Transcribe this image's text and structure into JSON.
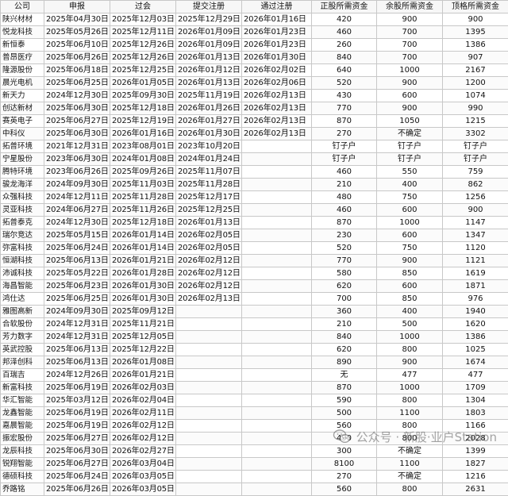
{
  "headers": [
    "公司",
    "申报",
    "过会",
    "提交注册",
    "通过注册",
    "正股所需资金",
    "余股所需资金",
    "顶格所需资金"
  ],
  "rows": [
    [
      "陕兴材材",
      "2025年04月30日",
      "2025年12月03日",
      "2025年12月29日",
      "2026年01月16日",
      "420",
      "900",
      "900"
    ],
    [
      "悦龙科技",
      "2025年05月26日",
      "2025年12月11日",
      "2026年01月09日",
      "2026年01月23日",
      "460",
      "700",
      "1395"
    ],
    [
      "新恒泰",
      "2025年06月10日",
      "2025年12月26日",
      "2026年01月09日",
      "2026年01月23日",
      "260",
      "700",
      "1386"
    ],
    [
      "普昂医疗",
      "2025年06月26日",
      "2025年12月26日",
      "2026年01月13日",
      "2026年01月30日",
      "840",
      "700",
      "907"
    ],
    [
      "隆源股份",
      "2025年06月18日",
      "2025年12月25日",
      "2026年01月12日",
      "2026年02月02日",
      "640",
      "1000",
      "2167"
    ],
    [
      "晨光电机",
      "2025年06月25日",
      "2026年01月05日",
      "2026年01月13日",
      "2026年02月06日",
      "520",
      "900",
      "1200"
    ],
    [
      "新天力",
      "2024年12月30日",
      "2025年09月30日",
      "2025年11月19日",
      "2026年02月13日",
      "430",
      "600",
      "1074"
    ],
    [
      "创达新材",
      "2025年06月30日",
      "2025年12月18日",
      "2026年01月26日",
      "2026年02月13日",
      "770",
      "900",
      "990"
    ],
    [
      "赛英电子",
      "2025年06月27日",
      "2025年12月19日",
      "2026年01月27日",
      "2026年02月13日",
      "870",
      "1050",
      "1215"
    ],
    [
      "中科仪",
      "2025年06月30日",
      "2026年01月16日",
      "2026年01月30日",
      "2026年02月13日",
      "270",
      "不确定",
      "3302"
    ],
    [
      "拓普环境",
      "2021年12月31日",
      "2023年08月01日",
      "2023年10月20日",
      "",
      "钉子户",
      "钉子户",
      "钉子户"
    ],
    [
      "宁星股份",
      "2023年06月30日",
      "2024年01月08日",
      "2024年01月24日",
      "",
      "钉子户",
      "钉子户",
      "钉子户"
    ],
    [
      "腾特环境",
      "2023年06月26日",
      "2025年09月26日",
      "2025年11月07日",
      "",
      "460",
      "550",
      "759"
    ],
    [
      "骏龙海洋",
      "2024年09月30日",
      "2025年11月03日",
      "2025年11月28日",
      "",
      "210",
      "400",
      "862"
    ],
    [
      "众强科技",
      "2024年12月11日",
      "2025年11月28日",
      "2025年12月17日",
      "",
      "480",
      "750",
      "1256"
    ],
    [
      "灵亚科技",
      "2024年06月27日",
      "2025年11月26日",
      "2025年12月25日",
      "",
      "460",
      "600",
      "900"
    ],
    [
      "拓普泰克",
      "2024年12月30日",
      "2025年12月18日",
      "2026年01月13日",
      "",
      "870",
      "1000",
      "1147"
    ],
    [
      "瑞尔竞达",
      "2025年05月15日",
      "2026年01月14日",
      "2026年02月05日",
      "",
      "230",
      "600",
      "1347"
    ],
    [
      "弥富科技",
      "2025年06月24日",
      "2026年01月14日",
      "2026年02月05日",
      "",
      "520",
      "750",
      "1120"
    ],
    [
      "恒湖科技",
      "2025年06月13日",
      "2026年01月21日",
      "2026年02月12日",
      "",
      "770",
      "900",
      "1121"
    ],
    [
      "沛诚科技",
      "2025年05月22日",
      "2026年01月28日",
      "2026年02月12日",
      "",
      "580",
      "850",
      "1619"
    ],
    [
      "海昌智能",
      "2025年06月23日",
      "2026年01月30日",
      "2026年02月12日",
      "",
      "620",
      "600",
      "1871"
    ],
    [
      "鸿仕达",
      "2025年06月25日",
      "2026年01月30日",
      "2026年02月13日",
      "",
      "700",
      "850",
      "976"
    ],
    [
      "雅图高新",
      "2024年09月30日",
      "2025年09月12日",
      "",
      "",
      "360",
      "400",
      "1940"
    ],
    [
      "合软股份",
      "2024年12月31日",
      "2025年11月21日",
      "",
      "",
      "210",
      "500",
      "1620"
    ],
    [
      "芳力数字",
      "2024年12月31日",
      "2025年12月05日",
      "",
      "",
      "840",
      "1000",
      "1386"
    ],
    [
      "英武控股",
      "2025年06月13日",
      "2025年12月22日",
      "",
      "",
      "620",
      "800",
      "1025"
    ],
    [
      "邦泽创科",
      "2025年06月13日",
      "2026年01月08日",
      "",
      "",
      "890",
      "900",
      "1674"
    ],
    [
      "百瑞吉",
      "2024年12月26日",
      "2026年01月21日",
      "",
      "",
      "无",
      "477",
      "477"
    ],
    [
      "新富科技",
      "2025年06月19日",
      "2026年02月03日",
      "",
      "",
      "870",
      "1000",
      "1709"
    ],
    [
      "华汇智能",
      "2025年03月12日",
      "2026年02月04日",
      "",
      "",
      "590",
      "800",
      "1304"
    ],
    [
      "龙鑫智能",
      "2025年06月19日",
      "2026年02月11日",
      "",
      "",
      "500",
      "1100",
      "1803"
    ],
    [
      "嘉晨智能",
      "2025年06月19日",
      "2026年02月12日",
      "",
      "",
      "560",
      "800",
      "1166"
    ],
    [
      "振宏股份",
      "2025年06月27日",
      "2026年02月12日",
      "",
      "",
      "490",
      "800",
      "2028"
    ],
    [
      "龙辰科技",
      "2025年06月30日",
      "2026年02月27日",
      "",
      "",
      "300",
      "不确定",
      "1399"
    ],
    [
      "锐翔智能",
      "2025年06月27日",
      "2026年03月04日",
      "",
      "",
      "8100",
      "1100",
      "1827"
    ],
    [
      "德硕科技",
      "2025年06月24日",
      "2026年03月05日",
      "",
      "",
      "270",
      "不确定",
      "1216"
    ],
    [
      "乔路铭",
      "2025年06月26日",
      "2026年03月05日",
      "",
      "",
      "560",
      "800",
      "2631"
    ]
  ],
  "watermark": {
    "text": "公众号 · 新股·业户Station",
    "icon": "wechat-bubbles-icon",
    "color": "#5a5a5a"
  }
}
